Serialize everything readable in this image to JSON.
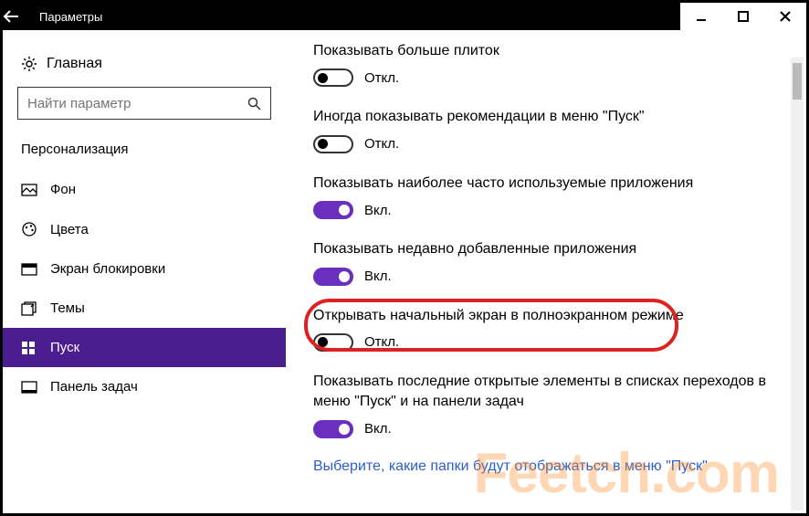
{
  "window": {
    "title": "Параметры"
  },
  "sidebar": {
    "home_label": "Главная",
    "search_placeholder": "Найти параметр",
    "category": "Персонализация",
    "items": [
      {
        "label": "Фон",
        "icon": "picture-icon"
      },
      {
        "label": "Цвета",
        "icon": "palette-icon"
      },
      {
        "label": "Экран блокировки",
        "icon": "lockscreen-icon"
      },
      {
        "label": "Темы",
        "icon": "themes-icon"
      },
      {
        "label": "Пуск",
        "icon": "start-icon"
      },
      {
        "label": "Панель задач",
        "icon": "taskbar-icon"
      }
    ]
  },
  "settings": [
    {
      "label": "Показывать больше плиток",
      "state": "off",
      "state_text": "Откл."
    },
    {
      "label": "Иногда показывать рекомендации в меню \"Пуск\"",
      "state": "off",
      "state_text": "Откл."
    },
    {
      "label": "Показывать наиболее часто используемые приложения",
      "state": "on",
      "state_text": "Вкл."
    },
    {
      "label": "Показывать недавно добавленные приложения",
      "state": "on",
      "state_text": "Вкл."
    },
    {
      "label": "Открывать начальный экран в полноэкранном режиме",
      "state": "off",
      "state_text": "Откл."
    },
    {
      "label": "Показывать последние открытые элементы в списках переходов в меню \"Пуск\" и на панели задач",
      "state": "on",
      "state_text": "Вкл."
    }
  ],
  "link_text": "Выберите, какие папки будут отображаться в меню \"Пуск\"",
  "watermark": "Feetch.com"
}
